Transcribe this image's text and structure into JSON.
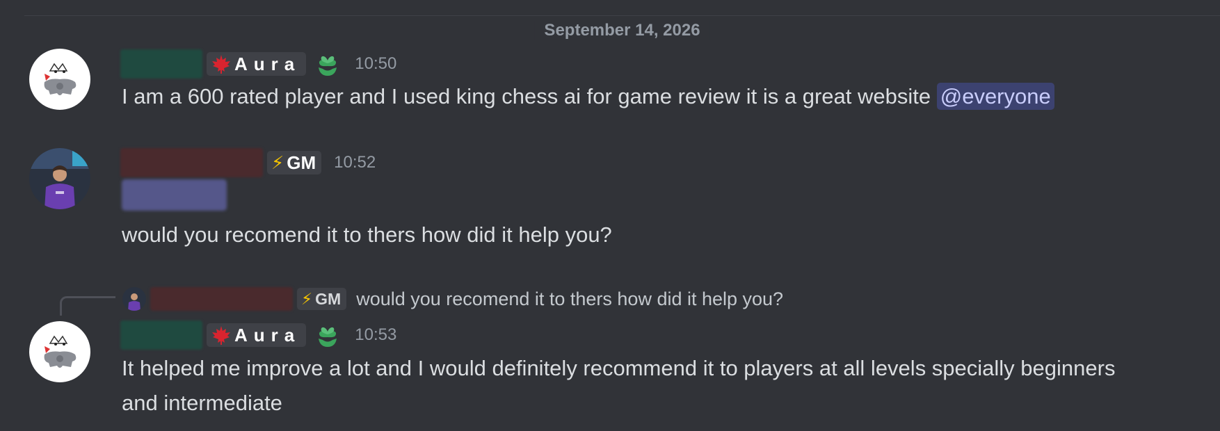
{
  "divider": {
    "date": "September 14, 2026"
  },
  "messages": [
    {
      "author_tag": "Aura",
      "tag_icon": "maple-leaf-icon",
      "badge": "heart-hands-icon",
      "timestamp": "10:50",
      "text": "I am a 600 rated player and I used king chess ai for game review it is a great website",
      "mention": "@everyone"
    },
    {
      "author_tag": "GM",
      "tag_icon": "lightning-icon",
      "tag_icon_glyph": "⚡",
      "timestamp": "10:52",
      "text": "would you recomend it to thers how did it help you?"
    },
    {
      "reply": {
        "author_tag": "GM",
        "tag_icon_glyph": "⚡",
        "text": "would you recomend it to thers how did it help you?"
      },
      "author_tag": "Aura",
      "tag_icon": "maple-leaf-icon",
      "badge": "heart-hands-icon",
      "timestamp": "10:53",
      "text_line1": "It helped me improve a lot and I would definitely recommend it to players at all levels specially beginners",
      "text_line2": "and intermediate"
    }
  ],
  "colors": {
    "background": "#313338",
    "mention_bg": "#3c4270",
    "mention_text": "#c9cdfb",
    "badge_green": "#3ba55c",
    "timestamp": "#949ba4"
  }
}
